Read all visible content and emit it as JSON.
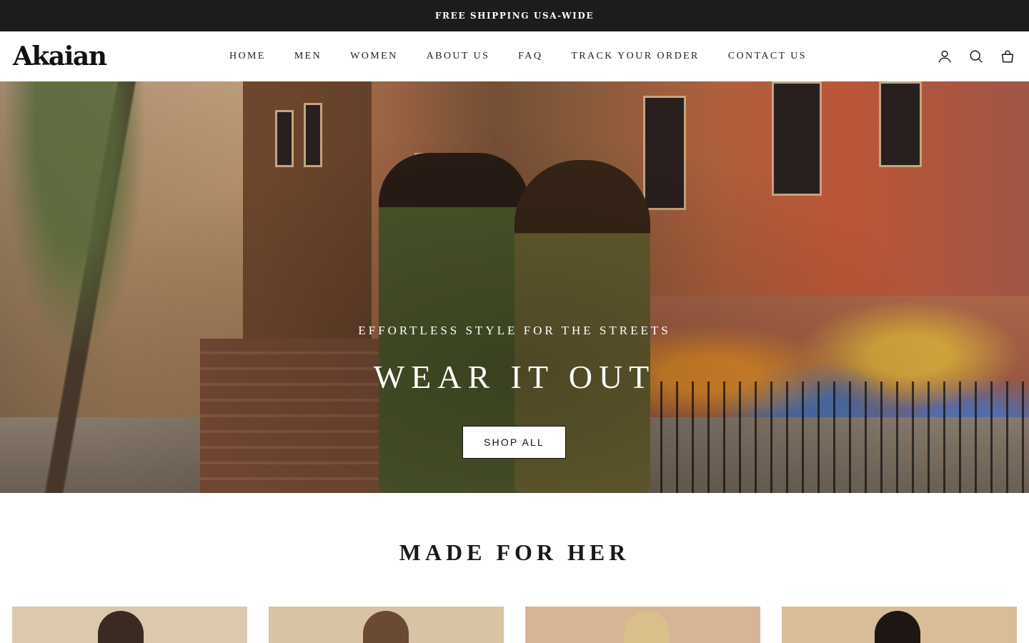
{
  "announcement": {
    "text": "FREE SHIPPING USA-WIDE"
  },
  "header": {
    "logo": "Akaian",
    "nav": [
      "HOME",
      "MEN",
      "WOMEN",
      "ABOUT US",
      "FAQ",
      "TRACK YOUR ORDER",
      "CONTACT US"
    ],
    "icons": [
      "account-icon",
      "search-icon",
      "cart-icon"
    ]
  },
  "hero": {
    "subtitle": "EFFORTLESS STYLE FOR THE STREETS",
    "title": "WEAR IT OUT",
    "button": "SHOP ALL"
  },
  "section": {
    "title": "MADE FOR HER",
    "cards": [
      {
        "bg": "#dcc9ad",
        "hair": "#3b2a22"
      },
      {
        "bg": "#d8c3a4",
        "hair": "#6b4a34"
      },
      {
        "bg": "#d6b496",
        "hair": "#d9c08a"
      },
      {
        "bg": "#d9bd98",
        "hair": "#1e1612"
      }
    ]
  },
  "colors": {
    "announcement_bg": "#1c1c1c",
    "text": "#1a1a1a",
    "accent": "#ffffff"
  }
}
